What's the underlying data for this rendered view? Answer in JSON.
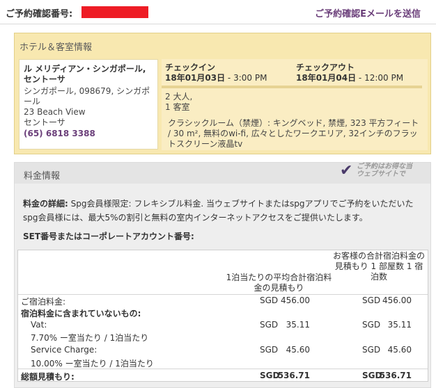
{
  "header": {
    "confirmation_label": "ご予約確認番号:",
    "resend_link": "ご予約確認Eメールを送信"
  },
  "hotel": {
    "section_title": "ホテル＆客室情報",
    "name": "ル メリディアン・シンガポール, セントーサ",
    "address_line1": "シンガポール, 098679, シンガポール",
    "address_line2": "23 Beach View",
    "address_line3": "セントーサ",
    "phone": "(65) 6818 3388"
  },
  "stay": {
    "checkin_label": "チェックイン",
    "checkin_date": "18年01月03日",
    "checkin_time": " - 3:00 PM",
    "checkout_label": "チェックアウト",
    "checkout_date": "18年01月04日",
    "checkout_time": " - 12:00 PM",
    "guests": "2 大人,",
    "rooms": "1 客室",
    "room_description": "クラシックルーム（禁煙）: キングベッド, 禁煙, 323 平方フィート / 30 m², 無料のwi-fi, 広々としたワークエリア, 32インチのフラットスクリーン液晶tv"
  },
  "rate": {
    "section_title": "料金情報",
    "badge_text_line1": "ご予約はお得な当",
    "badge_text_line2": "ウェブサイトで",
    "details_label": "料金の詳細:",
    "details_text": " Spg会員様限定: フレキシブル料金. 当ウェブサイトまたはspgアプリでご予約をいただいたspg会員様には、最大5%の割引と無料の室内インターネットアクセスをご提供いたします。",
    "set_label": "SET番号またはコーポレートアカウント番号:",
    "col1_header": "1泊当たりの平均合計宿泊料金の見積もり",
    "col2_header": "お客様の合計宿泊料金の見積もり 1 部屋数 1 宿泊数",
    "rows": [
      {
        "label": "ご宿泊料金:",
        "bold": false,
        "cur1": "SGD",
        "val1": "456.00",
        "cur2": "SGD",
        "val2": "456.00"
      },
      {
        "label": "宿泊料金に含まれていないもの:",
        "bold": true,
        "cur1": "",
        "val1": "",
        "cur2": "",
        "val2": ""
      },
      {
        "label": "Vat:",
        "bold": false,
        "cur1": "SGD",
        "val1": "35.11",
        "cur2": "SGD",
        "val2": "35.11"
      },
      {
        "label": "7.70% ー室当たり / 1泊当たり",
        "bold": false,
        "cur1": "",
        "val1": "",
        "cur2": "",
        "val2": ""
      },
      {
        "label": "Service Charge:",
        "bold": false,
        "cur1": "SGD",
        "val1": "45.60",
        "cur2": "SGD",
        "val2": "45.60"
      },
      {
        "label": "10.00% ー室当たり / 1泊当たり",
        "bold": false,
        "cur1": "",
        "val1": "",
        "cur2": "",
        "val2": ""
      },
      {
        "label": "総額見積もり:",
        "bold": true,
        "cur1": "SGD",
        "val1": "536.71",
        "cur2": "SGD",
        "val2": "536.71"
      }
    ]
  },
  "colors": {
    "link_purple": "#6b3f7a",
    "redaction_red": "#ee1c25",
    "hotel_bg": "#f8e8b0"
  }
}
